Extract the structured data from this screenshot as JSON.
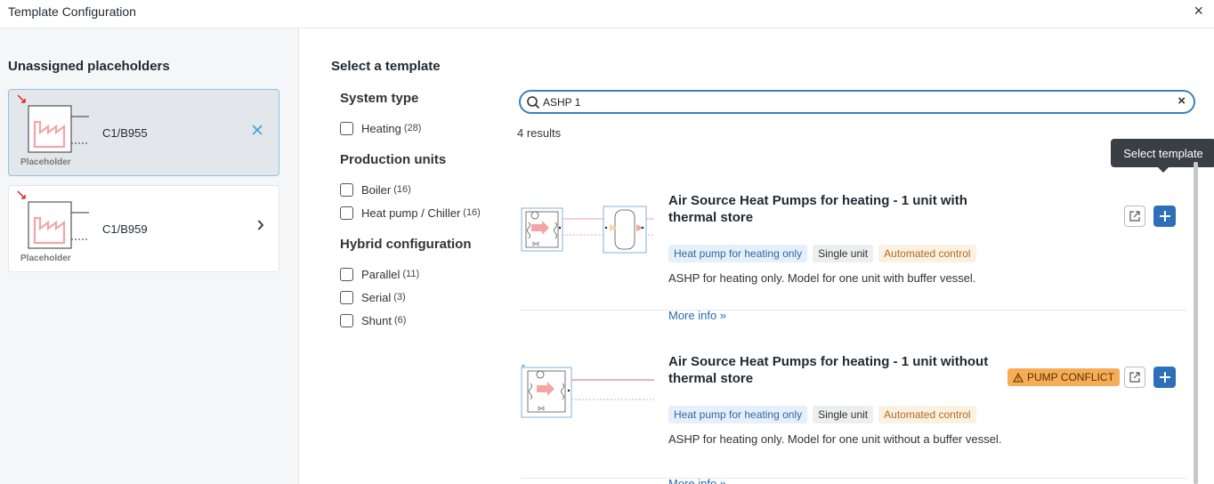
{
  "window": {
    "title": "Template Configuration",
    "close_glyph": "×"
  },
  "left": {
    "heading": "Unassigned placeholders",
    "placeholders": [
      {
        "code": "C1/B955",
        "label": "Placeholder",
        "selected": true,
        "action_glyph": "✕"
      },
      {
        "code": "C1/B959",
        "label": "Placeholder",
        "selected": false,
        "action_glyph": "›"
      }
    ]
  },
  "main": {
    "heading": "Select a template",
    "filters": [
      {
        "title": "System type",
        "items": [
          {
            "label": "Heating",
            "count": "(28)"
          }
        ]
      },
      {
        "title": "Production units",
        "items": [
          {
            "label": "Boiler",
            "count": "(16)"
          },
          {
            "label": "Heat pump / Chiller",
            "count": "(16)"
          }
        ]
      },
      {
        "title": "Hybrid configuration",
        "items": [
          {
            "label": "Parallel",
            "count": "(11)"
          },
          {
            "label": "Serial",
            "count": "(3)"
          },
          {
            "label": "Shunt",
            "count": "(6)"
          }
        ]
      }
    ],
    "search": {
      "value": "ASHP 1",
      "clear_glyph": "×"
    },
    "results_text": "4 results",
    "tooltip": "Select template",
    "cards": [
      {
        "title": "Air Source Heat Pumps for heating - 1 unit with thermal store",
        "tags": [
          "Heat pump for heating only",
          "Single unit",
          "Automated control"
        ],
        "description": "ASHP for heating only. Model for one unit with buffer vessel.",
        "more": "More info »",
        "warning": null
      },
      {
        "title": "Air Source Heat Pumps for heating - 1 unit without thermal store",
        "tags": [
          "Heat pump for heating only",
          "Single unit",
          "Automated control"
        ],
        "description": "ASHP for heating only. Model for one unit without a buffer vessel.",
        "more": "More info »",
        "warning": "PUMP CONFLICT"
      }
    ]
  },
  "colors": {
    "accent": "#2d6fb8",
    "warning": "#f6ad55",
    "selected_bg": "#e3e7eb"
  },
  "icons": [
    "close-icon",
    "search-icon",
    "external-link-icon",
    "plus-icon",
    "warning-icon",
    "chevron-right-icon",
    "factory-icon"
  ]
}
